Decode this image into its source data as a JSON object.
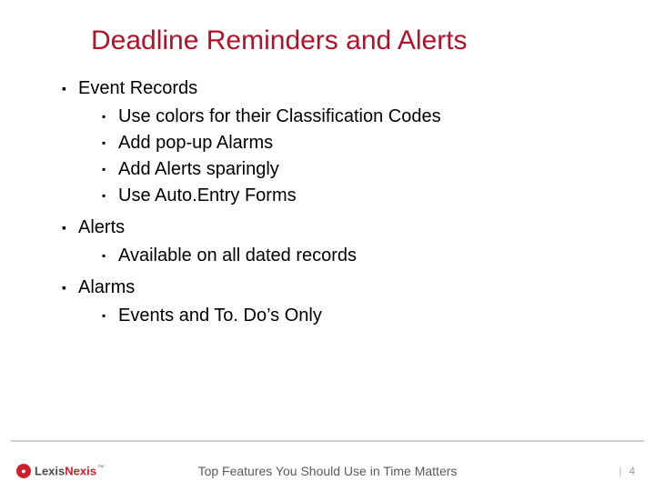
{
  "title": "Deadline Reminders and Alerts",
  "sections": [
    {
      "label": "Event Records",
      "items": [
        "Use colors for their Classification Codes",
        "Add pop-up Alarms",
        "Add Alerts sparingly",
        "Use Auto.Entry Forms"
      ]
    },
    {
      "label": "Alerts",
      "items": [
        "Available on all dated records"
      ]
    },
    {
      "label": "Alarms",
      "items": [
        "Events and To. Do’s Only"
      ]
    }
  ],
  "footer": {
    "brand_left": "Lexis",
    "brand_right": "Nexis",
    "tm": "™",
    "center": "Top Features You Should Use in Time Matters",
    "pipe": "|",
    "page": "4"
  },
  "bullet_glyph": "▪"
}
